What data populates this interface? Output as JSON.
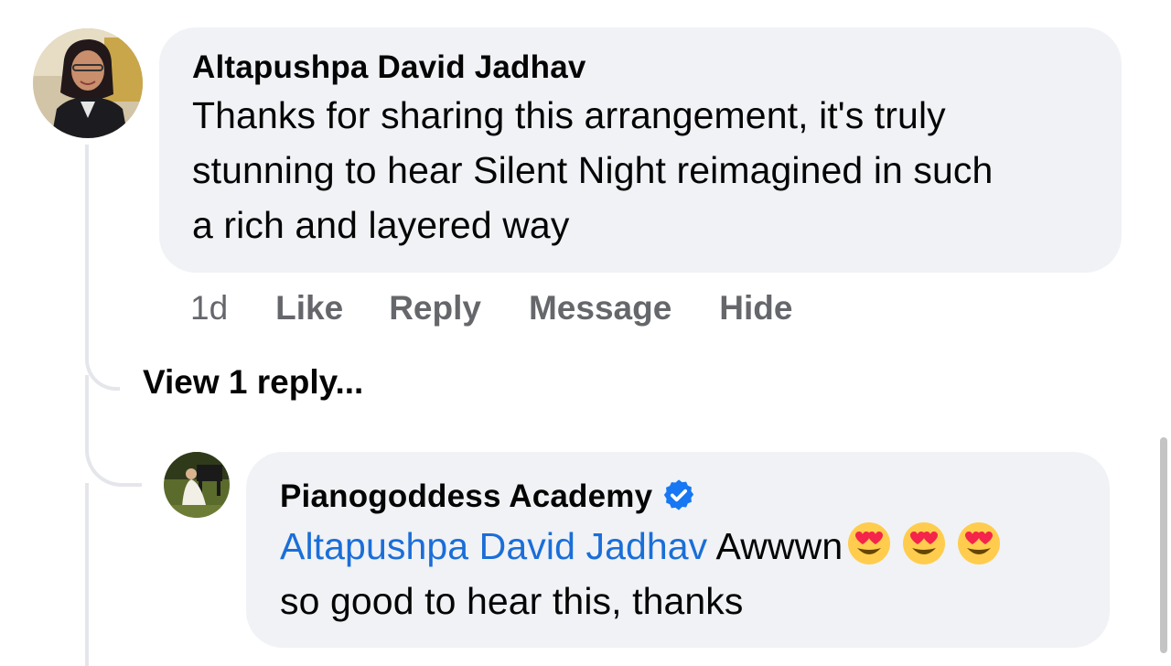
{
  "comment": {
    "author": "Altapushpa David Jadhav",
    "text_line1": "Thanks for sharing this arrangement, it's truly",
    "text_line2": "stunning to hear Silent Night reimagined in such",
    "text_line3": "a rich and layered way",
    "actions": {
      "time": "1d",
      "like": "Like",
      "reply": "Reply",
      "message": "Message",
      "hide": "Hide"
    }
  },
  "view_replies_label": "View 1 reply...",
  "reply": {
    "author": "Pianogoddess Academy",
    "mention": "Altapushpa David Jadhav",
    "text_start": "Awwwn",
    "text_line2": "so good to hear this, thanks",
    "verified_icon": "verified-badge-icon",
    "emoji_icon": "heart-eyes-emoji-icon"
  },
  "colors": {
    "bubble": "#f0f2f5",
    "secondary_text": "#65676b",
    "mention": "#1a6ed8",
    "verified": "#1877f2",
    "thread_line": "#e4e6eb"
  }
}
